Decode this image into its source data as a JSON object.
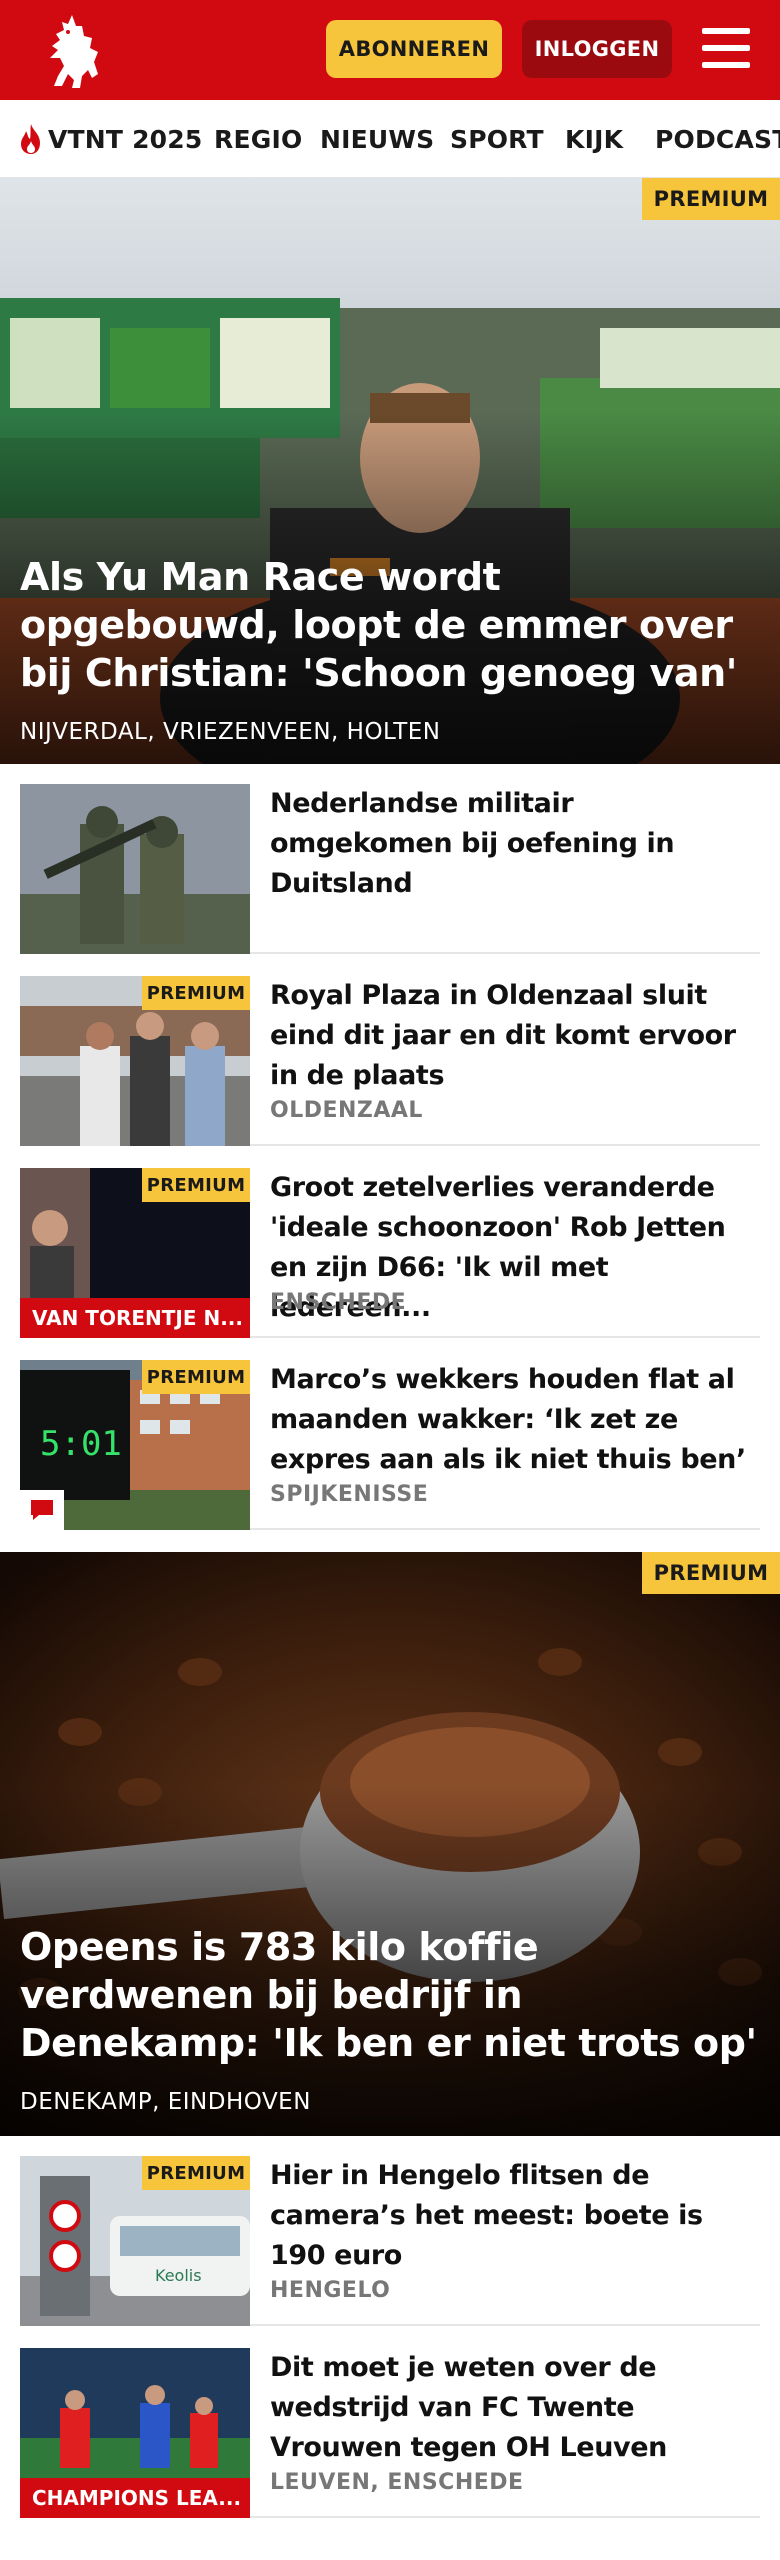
{
  "header": {
    "logo": "tubantia-horse-logo",
    "subscribe_label": "ABONNEREN",
    "login_label": "INLOGGEN",
    "menu_icon": "hamburger-menu-icon",
    "colors": {
      "brand": "#d10a11",
      "subscribe": "#f6c53b",
      "login": "#9b0a0e"
    }
  },
  "nav": {
    "items": [
      {
        "label": "VTNT 2025",
        "icon": "flame-icon"
      },
      {
        "label": "REGIO"
      },
      {
        "label": "NIEUWS"
      },
      {
        "label": "SPORT"
      },
      {
        "label": "KIJK"
      },
      {
        "label": "PODCAST"
      }
    ]
  },
  "premium_label": "PREMIUM",
  "articles": [
    {
      "title": "Als Yu Man Race wordt opgebouwd, loopt de emmer over bij Christian: 'Schoon genoeg van'",
      "location": "NIJVERDAL, VRIEZENVEEN, HOLTEN",
      "premium": true
    },
    {
      "title": "Nederlandse militair omgekomen bij oefening in Duitsland",
      "location": "",
      "premium": false
    },
    {
      "title": "Royal Plaza in Oldenzaal sluit eind dit jaar en dit komt ervoor in de plaats",
      "location": "OLDENZAAL",
      "premium": true
    },
    {
      "title": "Groot zetelverlies veranderde 'ideale schoonzoon' Rob Jetten en zijn D66: 'Ik wil met iedereen...",
      "location": "ENSCHEDE",
      "premium": true,
      "tag": "VAN TORENTJE N..."
    },
    {
      "title": "Marco’s wekkers houden flat al maanden wakker: ‘Ik zet ze expres aan als ik niet thuis ben’",
      "location": "SPIJKENISSE",
      "premium": true,
      "thumb_text": "5:01",
      "badge_icon": "comment-icon"
    },
    {
      "title": "Opeens is 783 kilo koffie verdwenen bij bedrijf in Denekamp: 'Ik ben er niet trots op'",
      "location": "DENEKAMP, EINDHOVEN",
      "premium": true
    },
    {
      "title": "Hier in Hengelo flitsen de camera’s het meest: boete is 190 euro",
      "location": "HENGELO",
      "premium": true,
      "thumb_text": "Keolis"
    },
    {
      "title": "Dit moet je weten over de wedstrijd van FC Twente Vrouwen tegen OH Leuven",
      "location": "LEUVEN, ENSCHEDE",
      "premium": false,
      "tag": "CHAMPIONS LEA..."
    }
  ]
}
